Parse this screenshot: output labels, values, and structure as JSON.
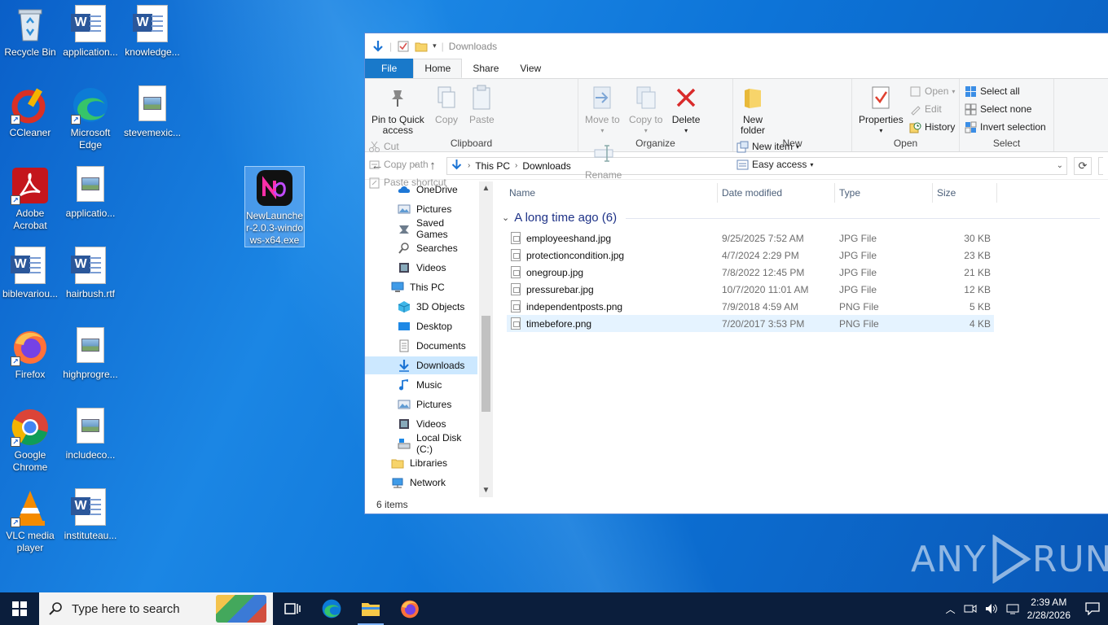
{
  "desktop": {
    "icons": [
      {
        "label": "Recycle Bin",
        "icon": "recycle-bin-icon"
      },
      {
        "label": "application...",
        "icon": "word-doc-icon"
      },
      {
        "label": "knowledge...",
        "icon": "word-doc-icon"
      },
      {
        "label": "CCleaner",
        "icon": "ccleaner-icon"
      },
      {
        "label": "Microsoft Edge",
        "icon": "edge-icon"
      },
      {
        "label": "stevemexic...",
        "icon": "image-file-icon"
      },
      {
        "label": "Adobe Acrobat",
        "icon": "acrobat-icon"
      },
      {
        "label": "applicatio...",
        "icon": "image-file-icon"
      },
      {
        "label": "NewLauncher-2.0.3-windows-x64.exe",
        "label_lines": [
          "NewLaunche",
          "r-2.0.3-windo",
          "ws-x64.exe"
        ],
        "icon": "newlauncher-icon"
      },
      {
        "label": "biblevariou...",
        "icon": "word-doc-icon"
      },
      {
        "label": "hairbush.rtf",
        "icon": "word-doc-icon"
      },
      {
        "label": "Firefox",
        "icon": "firefox-icon"
      },
      {
        "label": "highprogre...",
        "icon": "image-file-icon"
      },
      {
        "label": "Google Chrome",
        "icon": "chrome-icon"
      },
      {
        "label": "includeco...",
        "icon": "image-file-icon"
      },
      {
        "label": "VLC media player",
        "icon": "vlc-icon"
      },
      {
        "label": "instituteau...",
        "icon": "word-doc-icon"
      }
    ]
  },
  "explorer": {
    "title": "Downloads",
    "tabs": [
      "File",
      "Home",
      "Share",
      "View"
    ],
    "ribbon": {
      "clipboard": {
        "label": "Clipboard",
        "pin": "Pin to Quick access",
        "pin_lines": [
          "Pin to Quick",
          "access"
        ],
        "copy": "Copy",
        "paste": "Paste",
        "cut": "Cut",
        "copy_path": "Copy path",
        "paste_shortcut": "Paste shortcut"
      },
      "organize": {
        "label": "Organize",
        "move_to": "Move to",
        "copy_to": "Copy to",
        "delete": "Delete",
        "rename": "Rename"
      },
      "new": {
        "label": "New",
        "new_folder": "New folder",
        "new_folder_lines": [
          "New",
          "folder"
        ],
        "new_item": "New item",
        "easy_access": "Easy access"
      },
      "open": {
        "label": "Open",
        "properties": "Properties",
        "open": "Open",
        "edit": "Edit",
        "history": "History"
      },
      "select": {
        "label": "Select",
        "select_all": "Select all",
        "select_none": "Select none",
        "invert": "Invert selection"
      }
    },
    "address": {
      "crumbs": [
        "This PC",
        "Downloads"
      ]
    },
    "nav": [
      {
        "label": "OneDrive",
        "icon": "cloud-icon",
        "indent": 2
      },
      {
        "label": "Pictures",
        "icon": "pictures-icon",
        "indent": 2
      },
      {
        "label": "Saved Games",
        "icon": "saved-games-icon",
        "indent": 2
      },
      {
        "label": "Searches",
        "icon": "search-icon",
        "indent": 2
      },
      {
        "label": "Videos",
        "icon": "videos-icon",
        "indent": 2
      },
      {
        "label": "This PC",
        "icon": "this-pc-icon",
        "indent": 1
      },
      {
        "label": "3D Objects",
        "icon": "3d-objects-icon",
        "indent": 2
      },
      {
        "label": "Desktop",
        "icon": "desktop-icon",
        "indent": 2
      },
      {
        "label": "Documents",
        "icon": "documents-icon",
        "indent": 2
      },
      {
        "label": "Downloads",
        "icon": "downloads-icon",
        "indent": 2,
        "selected": true
      },
      {
        "label": "Music",
        "icon": "music-icon",
        "indent": 2
      },
      {
        "label": "Pictures",
        "icon": "pictures-icon",
        "indent": 2
      },
      {
        "label": "Videos",
        "icon": "videos-icon",
        "indent": 2
      },
      {
        "label": "Local Disk (C:)",
        "icon": "local-disk-icon",
        "indent": 2
      },
      {
        "label": "Libraries",
        "icon": "libraries-icon",
        "indent": 1
      },
      {
        "label": "Network",
        "icon": "network-icon",
        "indent": 1
      }
    ],
    "columns": [
      "Name",
      "Date modified",
      "Type",
      "Size"
    ],
    "group_header": "A long time ago (6)",
    "files": [
      {
        "name": "employeeshand.jpg",
        "date": "9/25/2025 7:52 AM",
        "type": "JPG File",
        "size": "30 KB"
      },
      {
        "name": "protectioncondition.jpg",
        "date": "4/7/2024 2:29 PM",
        "type": "JPG File",
        "size": "23 KB"
      },
      {
        "name": "onegroup.jpg",
        "date": "7/8/2022 12:45 PM",
        "type": "JPG File",
        "size": "21 KB"
      },
      {
        "name": "pressurebar.jpg",
        "date": "10/7/2020 11:01 AM",
        "type": "JPG File",
        "size": "12 KB"
      },
      {
        "name": "independentposts.png",
        "date": "7/9/2018 4:59 AM",
        "type": "PNG File",
        "size": "5 KB"
      },
      {
        "name": "timebefore.png",
        "date": "7/20/2017 3:53 PM",
        "type": "PNG File",
        "size": "4 KB",
        "selected": true
      }
    ],
    "status": "6 items"
  },
  "watermark": "ANY RUN",
  "watermark_parts": [
    "ANY",
    "RUN"
  ],
  "taskbar": {
    "search_placeholder": "Type here to search",
    "time": "2:39 AM",
    "date": "2/28/2026"
  },
  "colors": {
    "accent": "#1979ca",
    "selection": "#cce8ff",
    "taskbar": "#0b1e3c"
  }
}
